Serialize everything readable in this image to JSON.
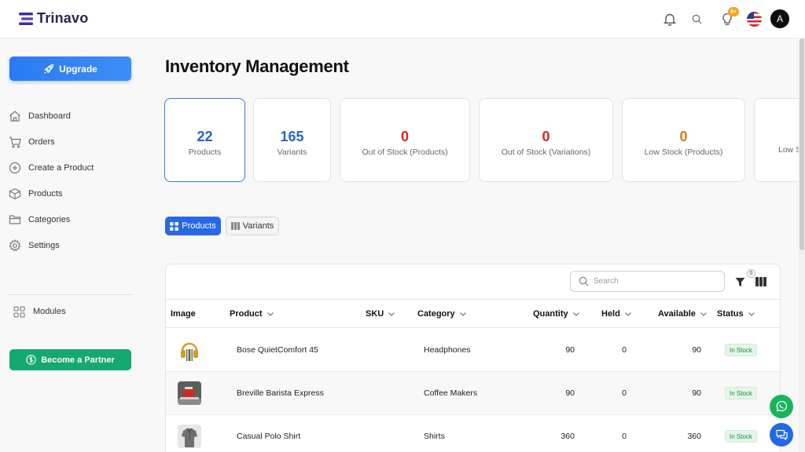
{
  "app": {
    "logo_text": "Trinavo"
  },
  "header": {
    "notification_badge": "9+",
    "avatar_initial": "A"
  },
  "sidebar": {
    "upgrade_label": "Upgrade",
    "items": [
      {
        "label": "Dashboard",
        "icon": "home-icon"
      },
      {
        "label": "Orders",
        "icon": "cart-icon"
      },
      {
        "label": "Create a Product",
        "icon": "plus-circle-icon"
      },
      {
        "label": "Products",
        "icon": "box-icon"
      },
      {
        "label": "Categories",
        "icon": "folder-icon"
      },
      {
        "label": "Settings",
        "icon": "gear-icon"
      }
    ],
    "modules_label": "Modules",
    "partner_label": "Become a Partner"
  },
  "page": {
    "title": "Inventory Management"
  },
  "stats": [
    {
      "value": "22",
      "label": "Products",
      "color": "#2a63c9"
    },
    {
      "value": "165",
      "label": "Variants",
      "color": "#2a63c9"
    },
    {
      "value": "0",
      "label": "Out of Stock (Products)",
      "color": "#d9252a"
    },
    {
      "value": "0",
      "label": "Out of Stock (Variations)",
      "color": "#d9252a"
    },
    {
      "value": "0",
      "label": "Low Stock (Products)",
      "color": "#e0781a"
    },
    {
      "value": "",
      "label": "Low S",
      "color": "#e0781a"
    }
  ],
  "tabs": {
    "products": "Products",
    "variants": "Variants"
  },
  "table": {
    "search_placeholder": "Search",
    "filter_count": "0",
    "columns": [
      "Image",
      "Product",
      "SKU",
      "Category",
      "Quantity",
      "Held",
      "Available",
      "Status"
    ],
    "rows": [
      {
        "product": "Bose QuietComfort 45",
        "sku": "",
        "category": "Headphones",
        "quantity": "90",
        "held": "0",
        "available": "90",
        "status": "In Stock"
      },
      {
        "product": "Breville Barista Express",
        "sku": "",
        "category": "Coffee Makers",
        "quantity": "90",
        "held": "0",
        "available": "90",
        "status": "In Stock"
      },
      {
        "product": "Casual Polo Shirt",
        "sku": "",
        "category": "Shirts",
        "quantity": "360",
        "held": "0",
        "available": "360",
        "status": "In Stock"
      }
    ]
  },
  "colors": {
    "primary": "#2868e6",
    "partner": "#15a86f",
    "whatsapp": "#19b55a"
  }
}
